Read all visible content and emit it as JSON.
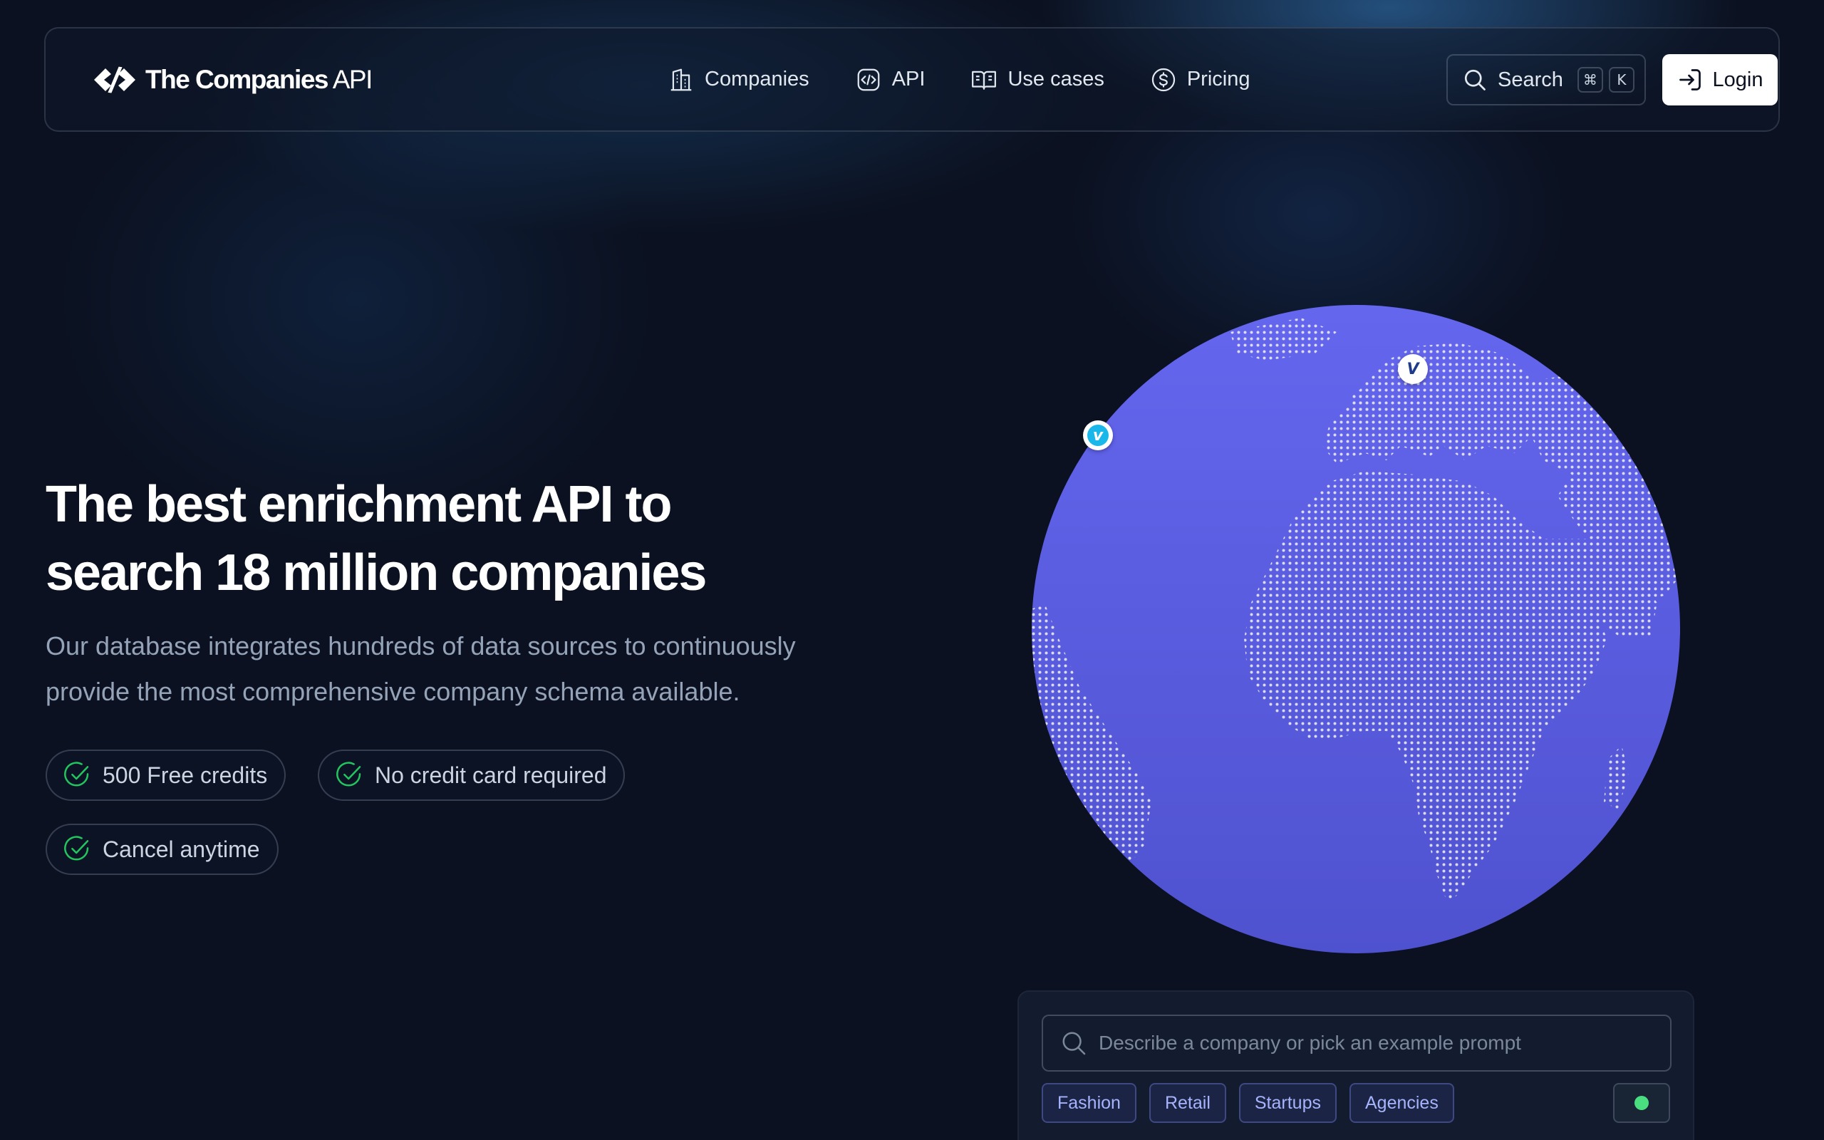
{
  "brand": {
    "name_bold": "The Companies",
    "name_light": "API"
  },
  "nav": {
    "items": [
      {
        "label": "Companies",
        "icon": "building-icon"
      },
      {
        "label": "API",
        "icon": "code-icon"
      },
      {
        "label": "Use cases",
        "icon": "book-icon"
      },
      {
        "label": "Pricing",
        "icon": "dollar-icon"
      }
    ],
    "search_label": "Search",
    "search_kbd": [
      "⌘",
      "K"
    ],
    "login_label": "Login"
  },
  "hero": {
    "title_line1": "The best enrichment API to",
    "title_line2": "search 18 million companies",
    "subtitle_line1": "Our database integrates hundreds of data sources to continuously",
    "subtitle_line2": "provide the most comprehensive company schema available.",
    "badges": [
      "500 Free credits",
      "No credit card required",
      "Cancel anytime"
    ]
  },
  "globe": {
    "markers": [
      {
        "label": "v",
        "brand": "vimeo",
        "color": "#1ab7ea"
      },
      {
        "label": "V",
        "brand": "venmo",
        "color": "#1e3a8a"
      }
    ],
    "colors": {
      "sphere_top": "#6466ee",
      "sphere_bottom": "#4f52cf",
      "dots": "#e5e7ef"
    }
  },
  "prompt": {
    "placeholder": "Describe a company or pick an example prompt",
    "tags": [
      "Fashion",
      "Retail",
      "Startups",
      "Agencies"
    ],
    "status_color": "#4ade80"
  },
  "colors": {
    "background": "#0b1120",
    "accent": "#6366f1",
    "check": "#22c55e"
  }
}
